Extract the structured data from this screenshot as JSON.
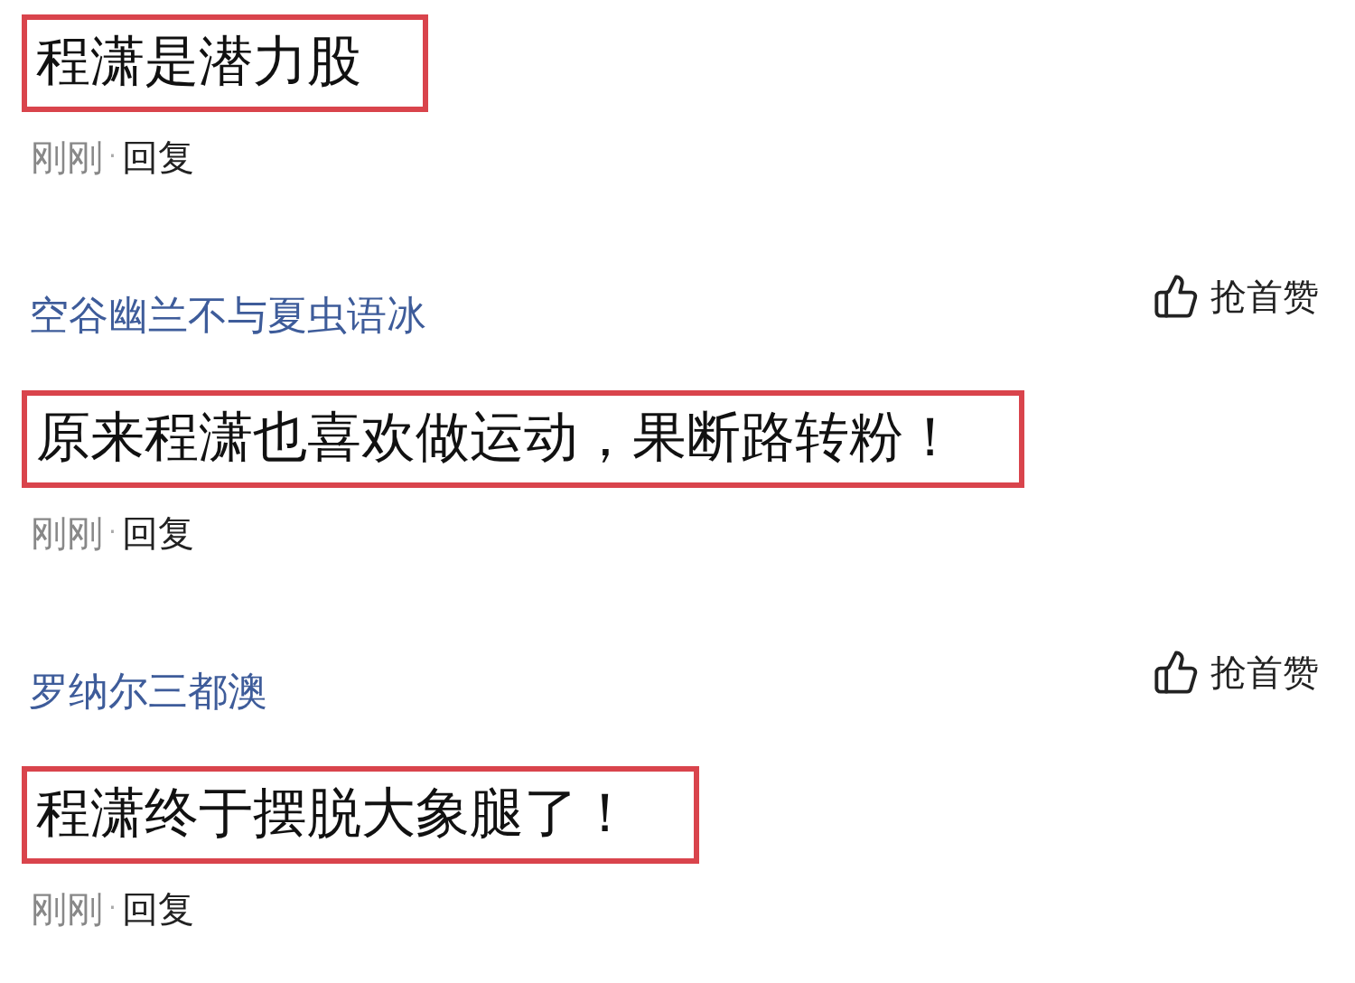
{
  "comments": [
    {
      "text": "程潇是潜力股",
      "highlighted": true,
      "meta": {
        "time": "刚刚",
        "separator": "·",
        "reply": "回复"
      }
    },
    {
      "author": "空谷幽兰不与夏虫语冰",
      "like_label": "抢首赞",
      "text": "原来程潇也喜欢做运动，果断路转粉！",
      "highlighted": true,
      "meta": {
        "time": "刚刚",
        "separator": "·",
        "reply": "回复"
      }
    },
    {
      "author": "罗纳尔三都澳",
      "like_label": "抢首赞",
      "text": "程潇终于摆脱大象腿了！",
      "highlighted": true,
      "meta": {
        "time": "刚刚",
        "separator": "·",
        "reply": "回复"
      }
    }
  ]
}
